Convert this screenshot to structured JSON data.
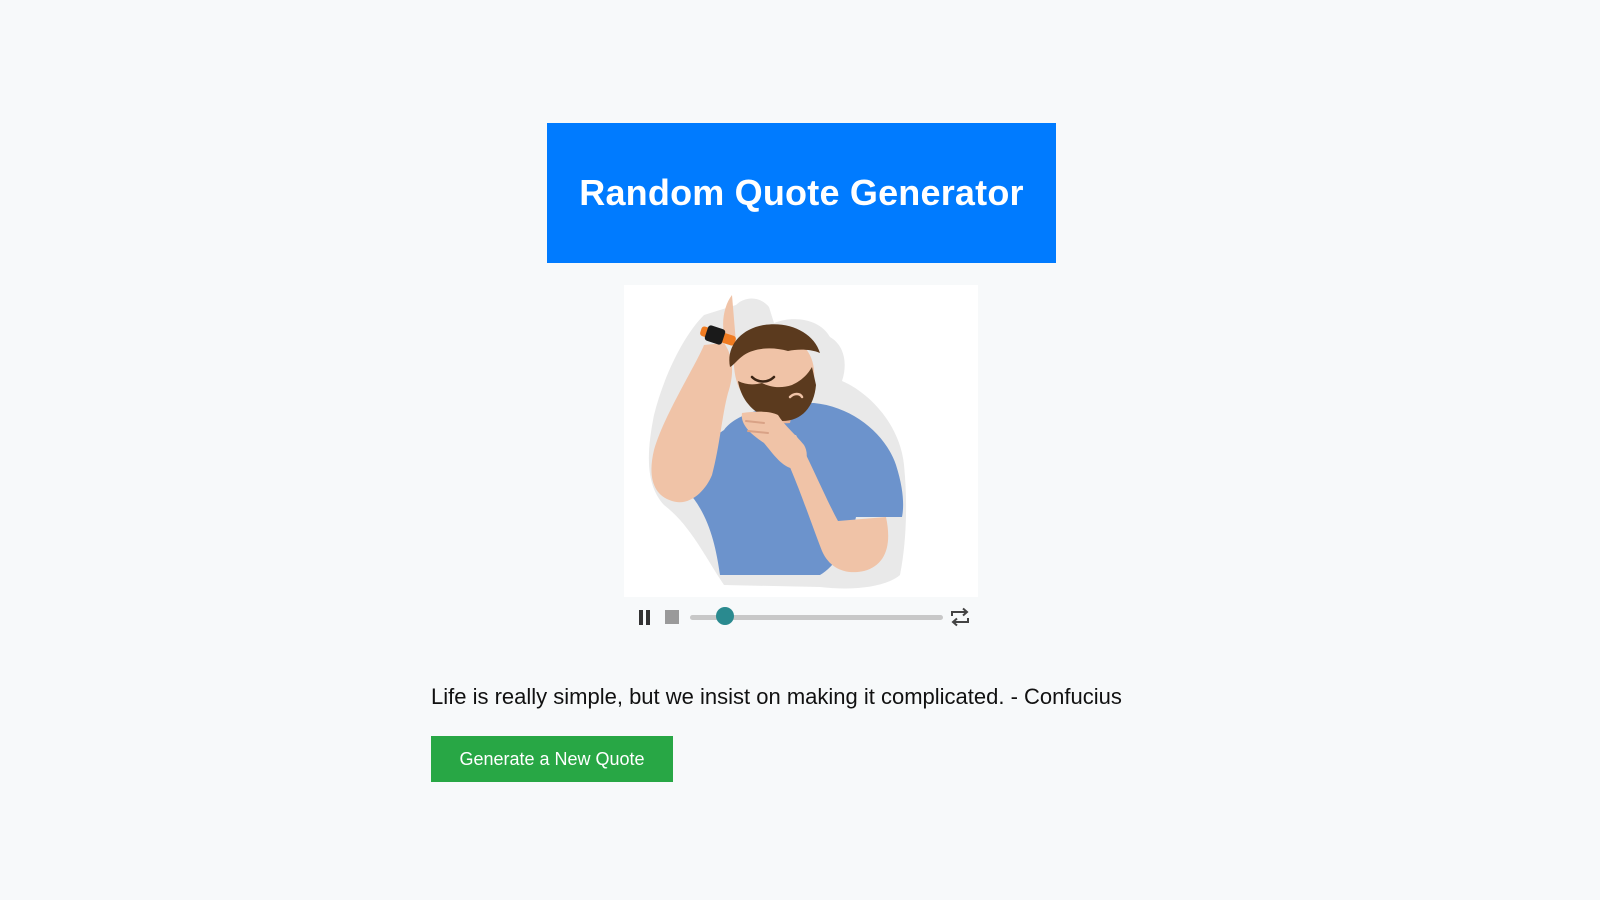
{
  "header": {
    "title": "Random Quote Generator"
  },
  "animation": {
    "illustration": "thinking-man-stroking-beard",
    "player": {
      "state": "playing",
      "progress": 0.14
    }
  },
  "quote": {
    "text": "Life is really simple, but we insist on making it complicated. - Confucius"
  },
  "actions": {
    "generate_label": "Generate a New Quote"
  },
  "colors": {
    "header_bg": "#007bff",
    "button_bg": "#28a745",
    "seek_thumb": "#2a8a8f",
    "page_bg": "#f7f9fa"
  }
}
